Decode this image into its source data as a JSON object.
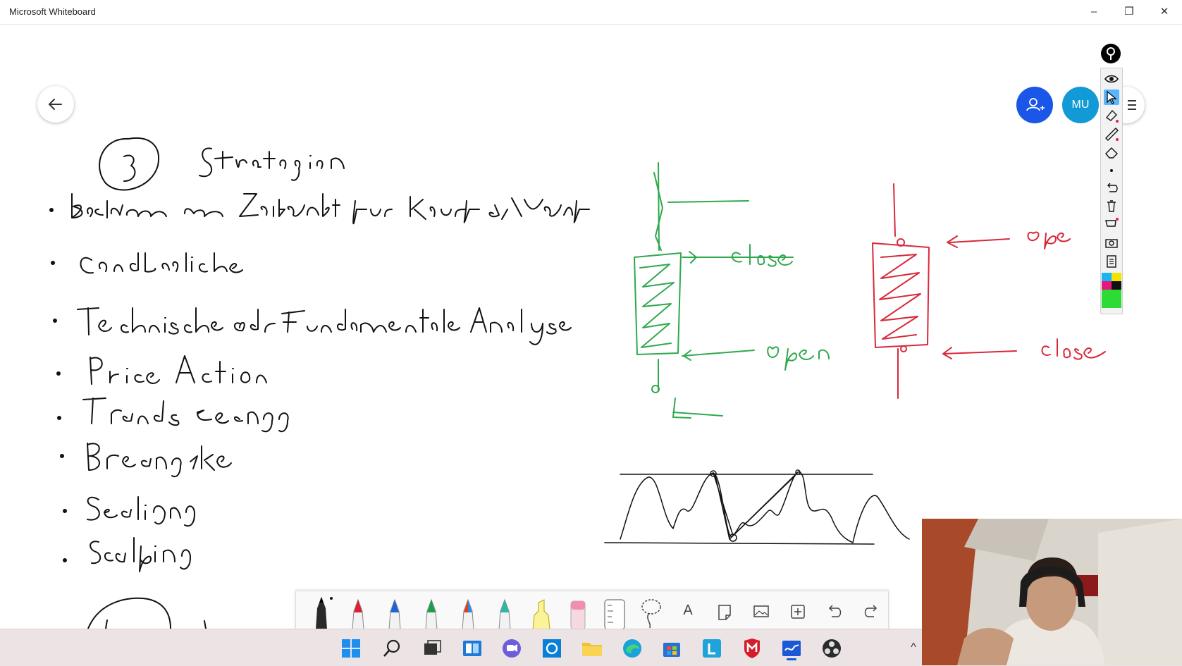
{
  "app": {
    "title": "Microsoft Whiteboard"
  },
  "window_controls": {
    "minimize": "–",
    "maximize": "❐",
    "close": "✕"
  },
  "header": {
    "avatar_initials": "MU"
  },
  "colors": {
    "accent_blue": "#1a56e8",
    "avatar_blue": "#129ad6",
    "ink_black": "#111111",
    "ink_green": "#2fa84f",
    "ink_red": "#d9283a"
  },
  "side_toolbar": {
    "items": [
      "eye-icon",
      "pointer-icon",
      "highlighter-icon",
      "ruler-icon",
      "eraser-icon",
      "dot-icon",
      "undo-icon",
      "trash-icon",
      "cart-icon",
      "camera-icon",
      "clipboard-icon",
      "palette-icon"
    ]
  },
  "pen_toolbar": {
    "tools": [
      "black-pen",
      "red-pen",
      "blue-pen",
      "green-pen",
      "rainbow-pen",
      "galaxy-pen",
      "highlighter",
      "eraser",
      "ruler",
      "lasso",
      "text",
      "note",
      "image",
      "insert",
      "undo",
      "redo"
    ],
    "text_tool_label": "A"
  },
  "taskbar": {
    "apps": [
      "start",
      "search",
      "task-view",
      "widgets",
      "teams-chat",
      "cortana",
      "file-explorer",
      "edge",
      "store",
      "lightroom",
      "mcafee",
      "whiteboard",
      "obs"
    ],
    "tray_chevron": "^"
  }
}
